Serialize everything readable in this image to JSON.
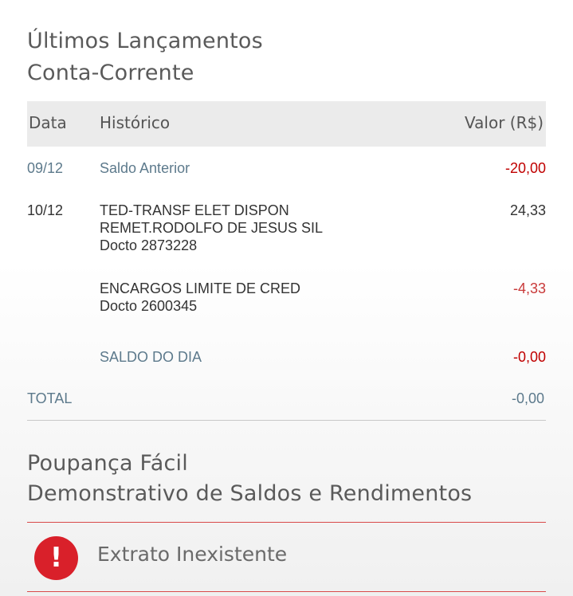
{
  "conta": {
    "title_line1": "Últimos Lançamentos",
    "title_line2": "Conta-Corrente",
    "headers": {
      "data": "Data",
      "historico": "Histórico",
      "valor": "Valor (R$)"
    },
    "rows": [
      {
        "data": "09/12",
        "historico": [
          "Saldo Anterior"
        ],
        "valor": "-20,00"
      },
      {
        "data": "10/12",
        "historico": [
          "TED-TRANSF ELET DISPON",
          "REMET.RODOLFO DE JESUS SIL",
          "Docto 2873228"
        ],
        "valor": "24,33"
      },
      {
        "data": "",
        "historico": [
          "ENCARGOS LIMITE DE CRED",
          "Docto 2600345"
        ],
        "valor": "-4,33"
      },
      {
        "data": "",
        "historico": [
          "SALDO DO DIA"
        ],
        "valor": "-0,00"
      }
    ],
    "total": {
      "label": "TOTAL",
      "valor": "-0,00"
    }
  },
  "poupanca": {
    "title_line1": "Poupança Fácil",
    "title_line2": "Demonstrativo de Saldos e Rendimentos",
    "alert_icon": "exclamation-icon",
    "alert_symbol": "!",
    "alert_text": "Extrato Inexistente"
  }
}
